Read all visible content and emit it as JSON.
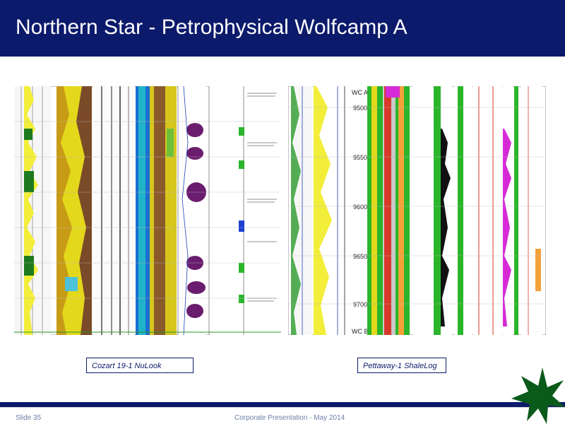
{
  "slide": {
    "title": "Northern Star -  Petrophysical Wolfcamp A",
    "slide_number": "Slide 35",
    "footer_text": "Corporate Presentation - May 2014"
  },
  "captions": {
    "left": "Cozart 19-1 NuLook",
    "right": "Pettaway-1 ShaleLog"
  },
  "right_log": {
    "top_marker": "WC A",
    "bottom_marker": "WC B",
    "depths": [
      "9500",
      "9550",
      "9600",
      "9650",
      "9700"
    ]
  },
  "colors": {
    "title_bar": "#0c1a6b",
    "caption_text": "#0c1a6b",
    "footer_text": "#6b7fa8",
    "star": "#0a5a1a"
  }
}
